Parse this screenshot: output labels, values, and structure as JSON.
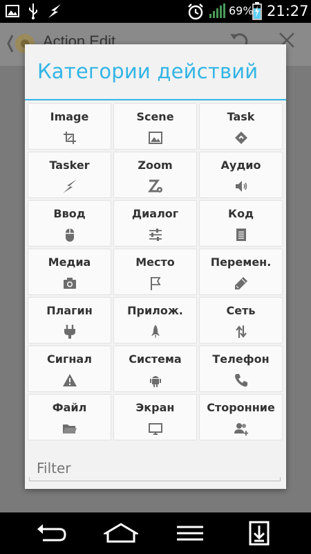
{
  "status_bar": {
    "battery_percent": "69%",
    "time": "21:27",
    "icons": [
      "image-icon",
      "usb-icon",
      "tasker-bolt-icon",
      "alarm-icon",
      "signal-icon",
      "battery-charging-icon"
    ]
  },
  "app_bar": {
    "title": "Action Edit",
    "icons": [
      "app-logo-icon",
      "undo-icon",
      "close-icon"
    ]
  },
  "dialog": {
    "title": "Категории действий",
    "categories": [
      {
        "label": "Image",
        "icon": "crop-icon"
      },
      {
        "label": "Scene",
        "icon": "picture-icon"
      },
      {
        "label": "Task",
        "icon": "task-diamond-icon"
      },
      {
        "label": "Tasker",
        "icon": "bolt-icon"
      },
      {
        "label": "Zoom",
        "icon": "zoom-gear-icon"
      },
      {
        "label": "Аудио",
        "icon": "speaker-icon"
      },
      {
        "label": "Ввод",
        "icon": "mouse-icon"
      },
      {
        "label": "Диалог",
        "icon": "sliders-icon"
      },
      {
        "label": "Код",
        "icon": "document-icon"
      },
      {
        "label": "Медиа",
        "icon": "camera-icon"
      },
      {
        "label": "Место",
        "icon": "flag-icon"
      },
      {
        "label": "Перемен.",
        "icon": "pencil-icon"
      },
      {
        "label": "Плагин",
        "icon": "plug-icon"
      },
      {
        "label": "Прилож.",
        "icon": "rocket-icon"
      },
      {
        "label": "Сеть",
        "icon": "arrows-updown-icon"
      },
      {
        "label": "Сигнал",
        "icon": "warning-icon"
      },
      {
        "label": "Система",
        "icon": "android-icon"
      },
      {
        "label": "Телефон",
        "icon": "phone-icon"
      },
      {
        "label": "Файл",
        "icon": "folder-icon"
      },
      {
        "label": "Экран",
        "icon": "monitor-icon"
      },
      {
        "label": "Сторонние",
        "icon": "group-add-icon"
      }
    ],
    "filter_placeholder": "Filter"
  },
  "nav_bar": {
    "icons": [
      "back-icon",
      "home-icon",
      "menu-icon",
      "download-icon"
    ]
  },
  "colors": {
    "accent": "#33b5e5",
    "dialog_bg": "#f2f2f2",
    "cell_bg": "#fafafa",
    "icon_gray": "#6d6d6d"
  }
}
